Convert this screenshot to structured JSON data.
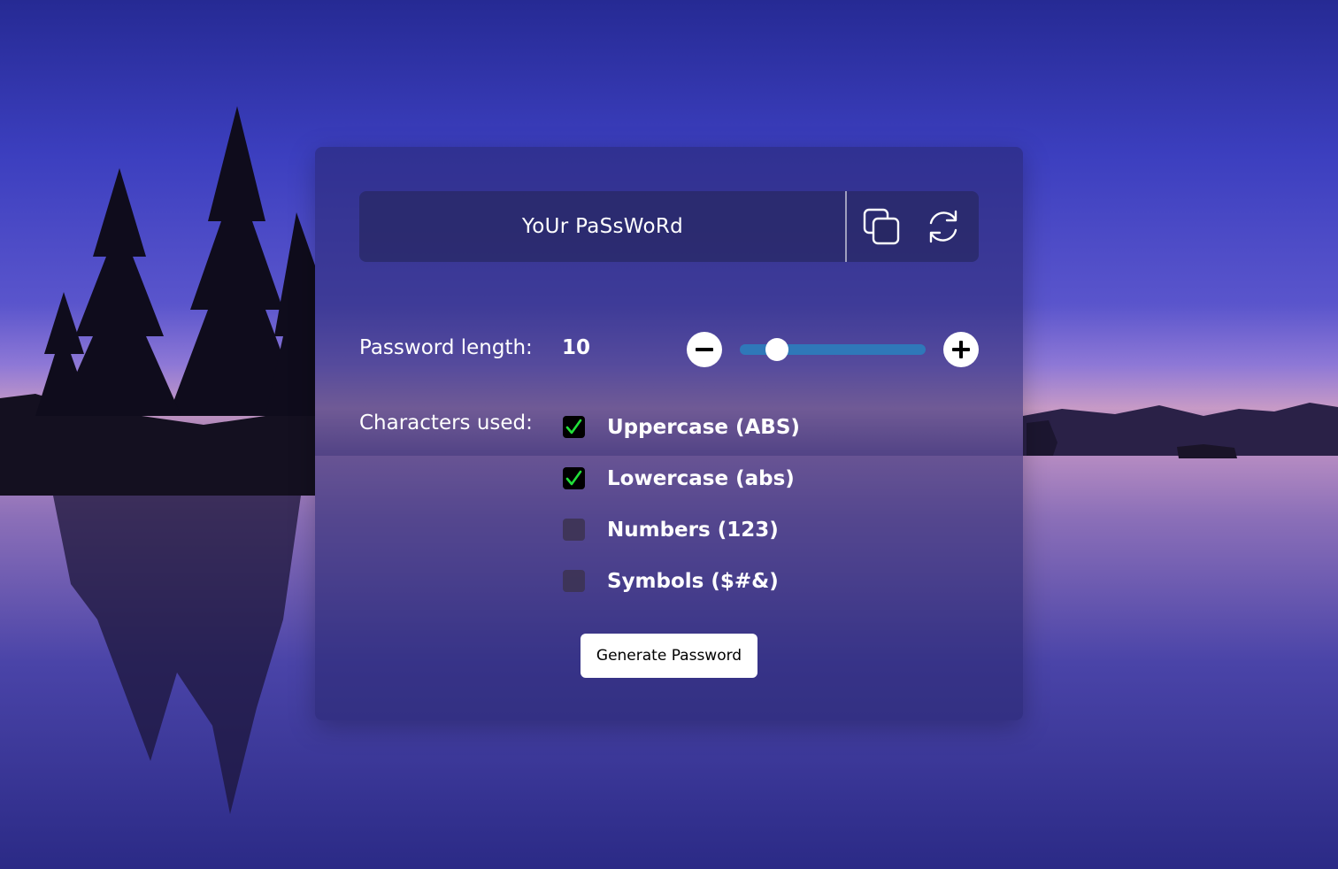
{
  "password_display": {
    "text": "YoUr PaSsWoRd",
    "copy_icon": "copy-icon",
    "refresh_icon": "refresh-icon"
  },
  "length": {
    "label": "Password length:",
    "value": "10",
    "slider_fraction": 0.2,
    "minus_icon": "minus-icon",
    "plus_icon": "plus-icon",
    "track_color": "#2f78b9"
  },
  "characters": {
    "label": "Characters used:",
    "options": [
      {
        "label": "Uppercase (ABS)",
        "checked": true
      },
      {
        "label": "Lowercase (abs)",
        "checked": true
      },
      {
        "label": "Numbers (123)",
        "checked": false
      },
      {
        "label": "Symbols ($#&)",
        "checked": false
      }
    ],
    "check_color": "#22e03a"
  },
  "generate_button": {
    "label": "Generate Password"
  }
}
